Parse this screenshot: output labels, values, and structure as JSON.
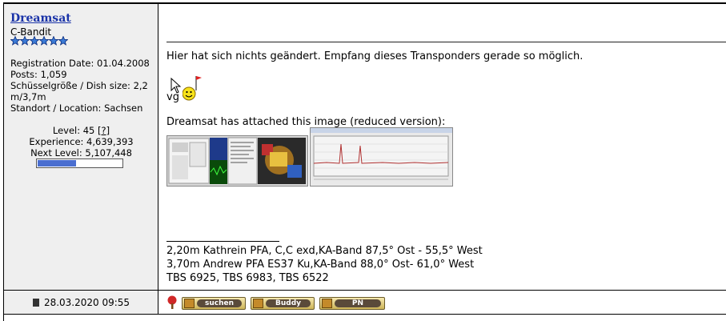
{
  "user": {
    "name": "Dreamsat",
    "rank": "C-Bandit",
    "info_lines": [
      "Registration Date: 01.04.2008",
      "Posts: 1,059",
      "Schüsselgröße / Dish size: 2,2",
      "m/3,7m",
      "Standort / Location: Sachsen"
    ],
    "level_label": "Level: 45",
    "level_help": "[?]",
    "experience": "Experience: 4,639,393",
    "next_level": "Next Level: 5,107,448",
    "level_progress_percent": 46
  },
  "post": {
    "message": "Hier hat sich nichts geändert. Empfang dieses Transponders gerade so möglich.",
    "closing": "vg",
    "attachment_caption": "Dreamsat has attached this image (reduced version):",
    "signature": [
      "2,20m Kathrein PFA, C,C exd,KA-Band 87,5° Ost - 55,5° West",
      "3,70m Andrew PFA ES37 Ku,KA-Band 88,0° Ost- 61,0° West",
      "TBS 6925, TBS 6983, TBS 6522"
    ]
  },
  "footer": {
    "date": "28.03.2020 09:55",
    "buttons": [
      {
        "label": "suchen",
        "icon": "search-icon"
      },
      {
        "label": "Buddy",
        "icon": "buddy-icon"
      },
      {
        "label": "PN",
        "icon": "pm-icon"
      }
    ]
  },
  "colors": {
    "username": "#1a33a8",
    "sidebar_bg": "#efefef",
    "level_bar": "#4a6ed0"
  }
}
